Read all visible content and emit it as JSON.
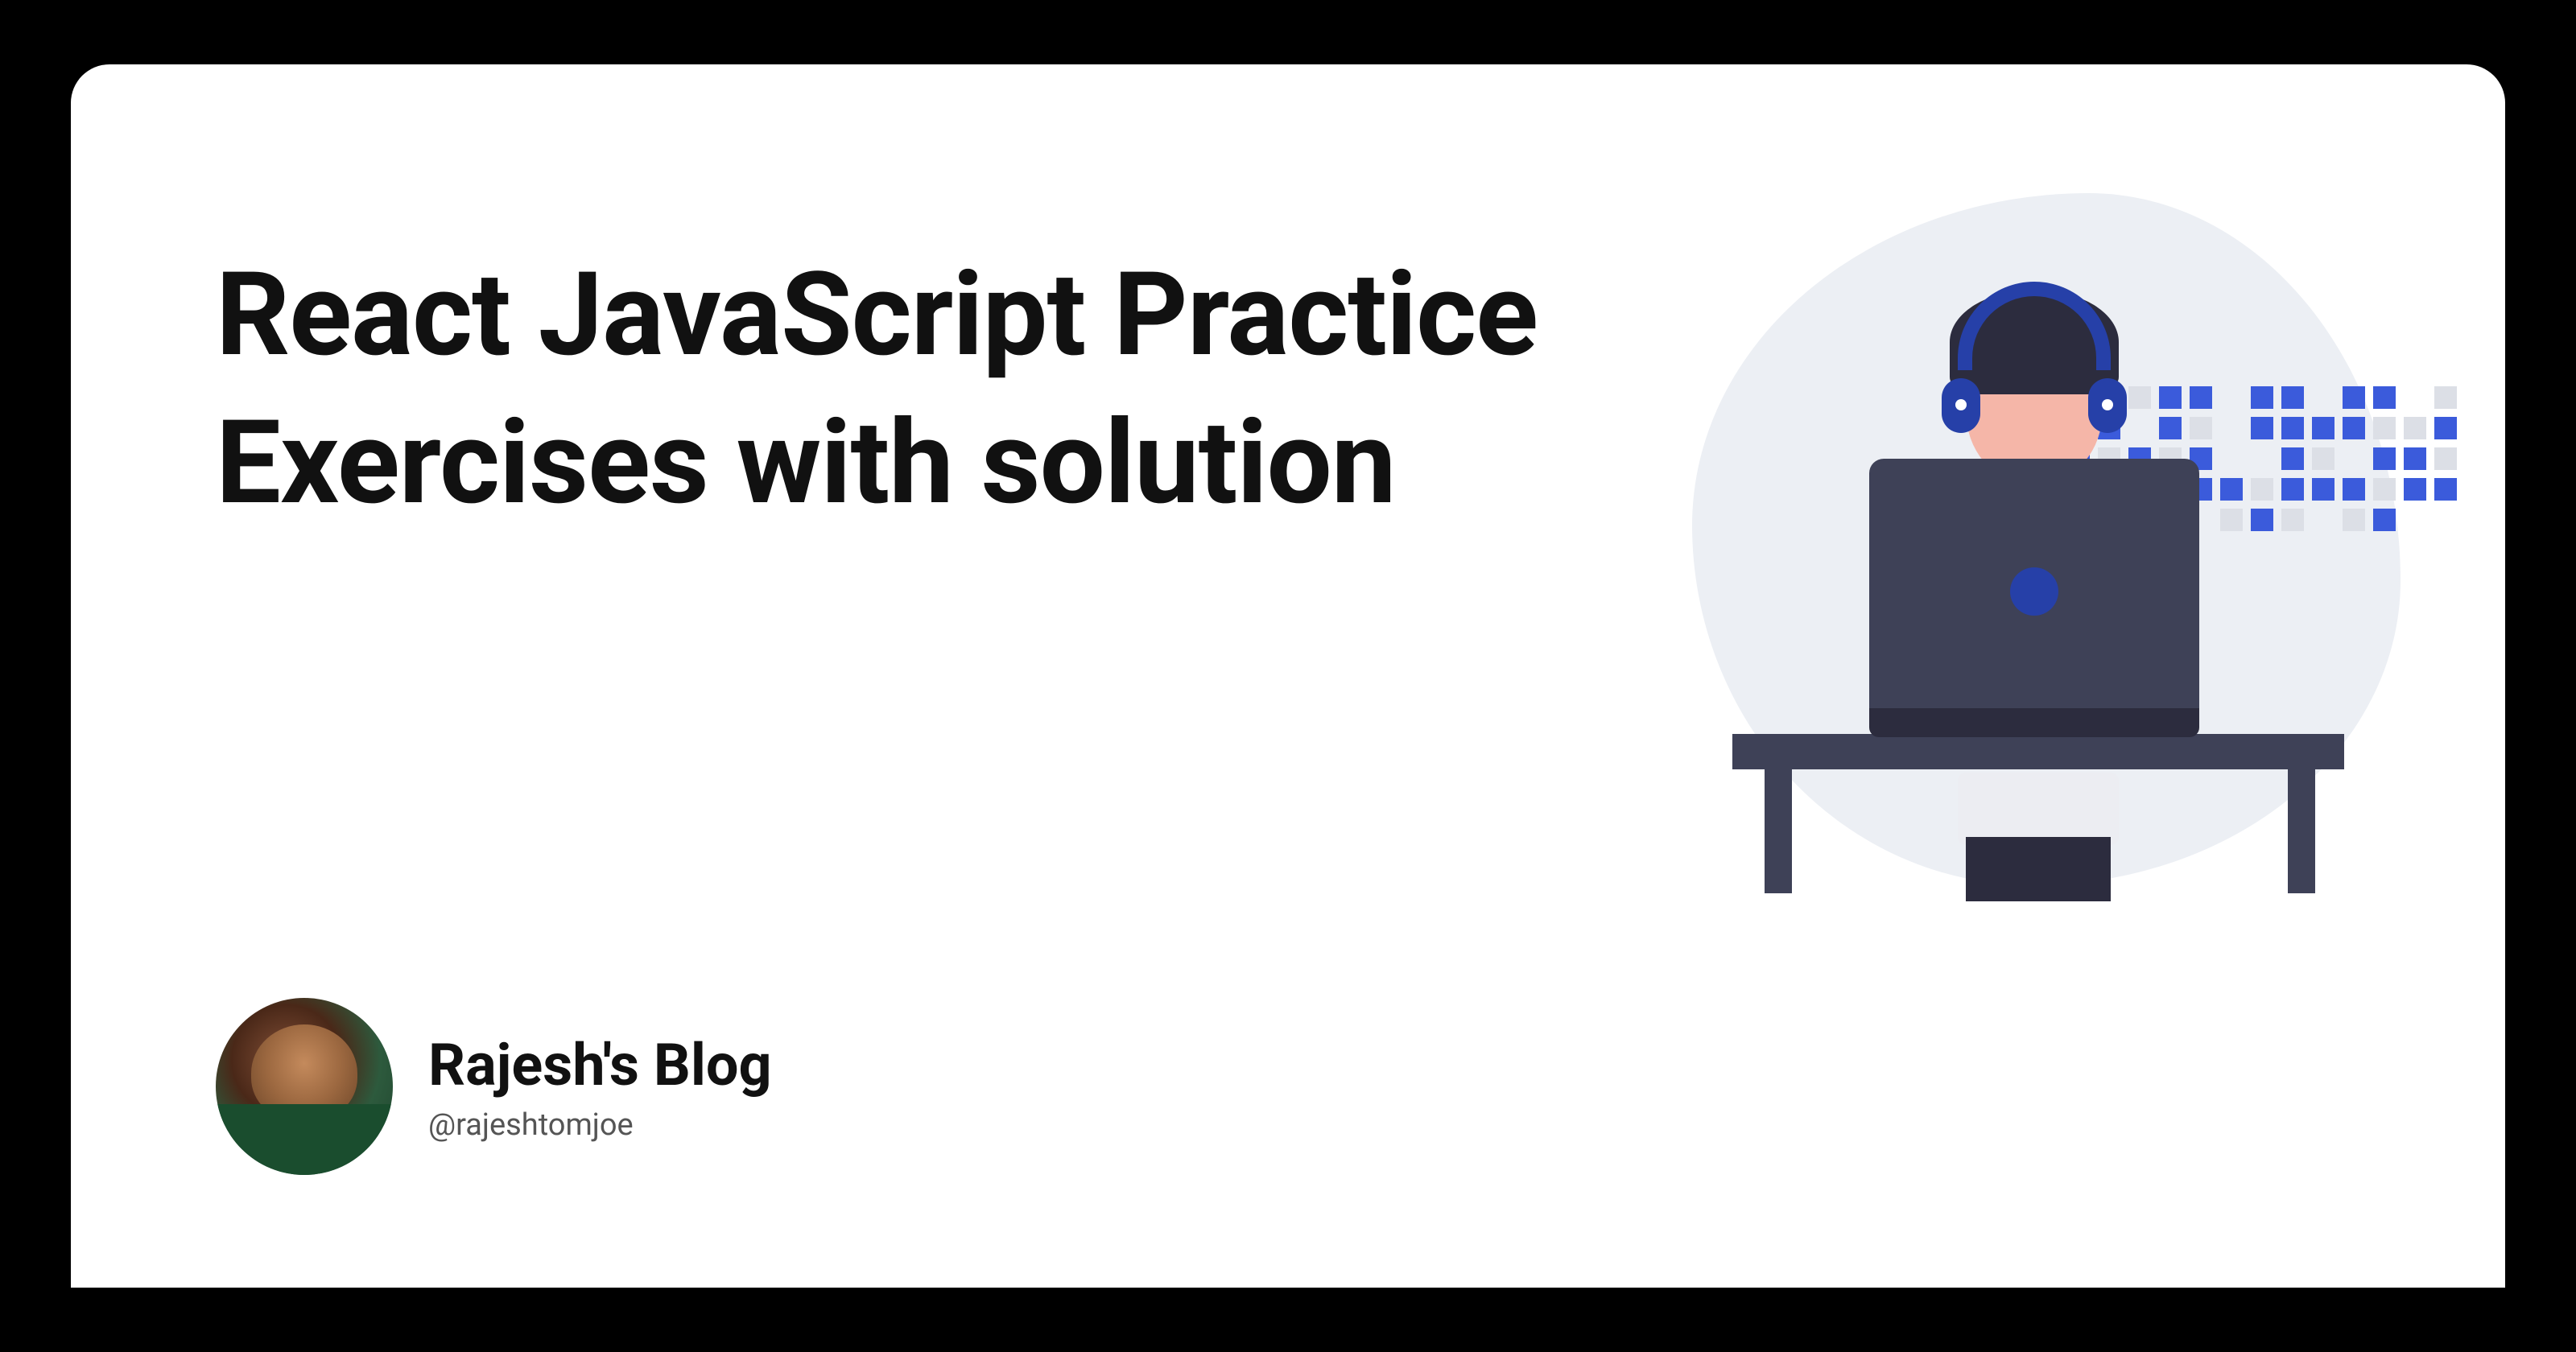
{
  "title": "React JavaScript Practice Exercises with solution",
  "author": {
    "blog_name": "Rajesh's Blog",
    "handle": "@rajeshtomjoe"
  },
  "illustration": {
    "description": "person-at-computer",
    "accent_color": "#3b5bdb",
    "pixel_grid": [
      [
        "e",
        "e",
        "g",
        "b",
        "b",
        "e",
        "b",
        "b",
        "e",
        "b",
        "b",
        "e",
        "g"
      ],
      [
        "g",
        "b",
        "e",
        "b",
        "g",
        "e",
        "b",
        "b",
        "b",
        "b",
        "g",
        "g",
        "b"
      ],
      [
        "b",
        "g",
        "b",
        "g",
        "b",
        "e",
        "e",
        "b",
        "g",
        "e",
        "b",
        "b",
        "g"
      ],
      [
        "g",
        "b",
        "b",
        "b",
        "b",
        "b",
        "g",
        "b",
        "b",
        "b",
        "g",
        "b",
        "b"
      ],
      [
        "e",
        "e",
        "b",
        "g",
        "e",
        "g",
        "b",
        "g",
        "e",
        "g",
        "b",
        "e",
        "e"
      ]
    ]
  }
}
